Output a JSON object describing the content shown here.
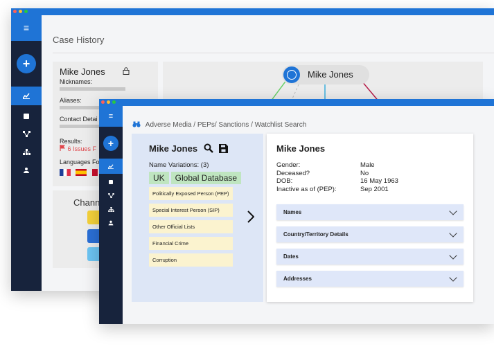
{
  "back_window": {
    "page_title": "Case History",
    "profile": {
      "name": "Mike Jones",
      "nicknames_label": "Nicknames:",
      "aliases_label": "Aliases:",
      "contact_label": "Contact Detai",
      "results_label": "Results:",
      "issues_text": "6 Issues F",
      "languages_label": "Languages Fo"
    },
    "channels_label": "Chann",
    "graph_node": "Mike Jones"
  },
  "front_window": {
    "breadcrumb": "Adverse Media / PEPs/ Sanctions / Watchlist Search",
    "card": {
      "name": "Mike Jones",
      "name_variations": "Name Variations: (3)",
      "tags": [
        "UK",
        "Global Database"
      ],
      "categories": [
        "Politically Exposed Person (PEP)",
        "Special Interest Person (SIP)",
        "Other Official Lists",
        "Financial Crime",
        "Corruption"
      ]
    },
    "detail": {
      "title": "Mike Jones",
      "rows": [
        {
          "label": "Gender:",
          "value": "Male"
        },
        {
          "label": "Deceased?",
          "value": "No"
        },
        {
          "label": "DOB:",
          "value": "16 May 1963"
        },
        {
          "label": "Inactive as of (PEP):",
          "value": "Sep 2001"
        }
      ],
      "sections": [
        "Names",
        "Country/Territory Details",
        "Dates",
        "Addresses"
      ]
    }
  },
  "colors": {
    "accent": "#1f74d6",
    "sidebar": "#17233c",
    "tag": "#bfe5c0",
    "pill": "#fbf3cf",
    "accordion": "#dfe7f9",
    "card": "#dde6f6",
    "issue": "#e0474c"
  },
  "icons": [
    "menu-icon",
    "plus-icon",
    "chart-icon",
    "copy-icon",
    "network-icon",
    "hierarchy-icon",
    "person-icon",
    "lock-icon",
    "search-icon",
    "save-icon",
    "binoculars-icon",
    "chevron-right-icon",
    "chevron-down-icon",
    "flag-icon"
  ]
}
